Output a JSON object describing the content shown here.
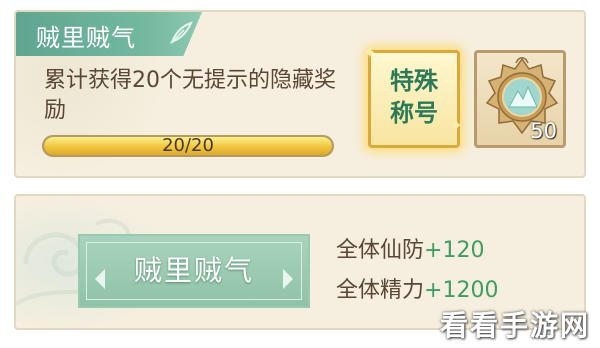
{
  "achievement": {
    "title": "贼里贼气",
    "icon": "leaf-icon",
    "description": "累计获得20个无提示的隐藏奖励",
    "progress": {
      "text": "20/20",
      "fraction": 1.0
    }
  },
  "rewards": [
    {
      "kind": "special-title",
      "label": "特殊称号"
    },
    {
      "kind": "badge",
      "icon": "mountain-medallion-icon",
      "count": "50"
    }
  ],
  "title_reward": {
    "name": "贼里贼气",
    "stats": [
      {
        "label": "全体仙防",
        "value": "+120"
      },
      {
        "label": "全体精力",
        "value": "+1200"
      }
    ]
  },
  "watermark": "看看手游网",
  "colors": {
    "accent_green": "#5fa58f",
    "value_green": "#3f9c62",
    "text_brown": "#5a4634",
    "gold": "#f0c53d"
  }
}
